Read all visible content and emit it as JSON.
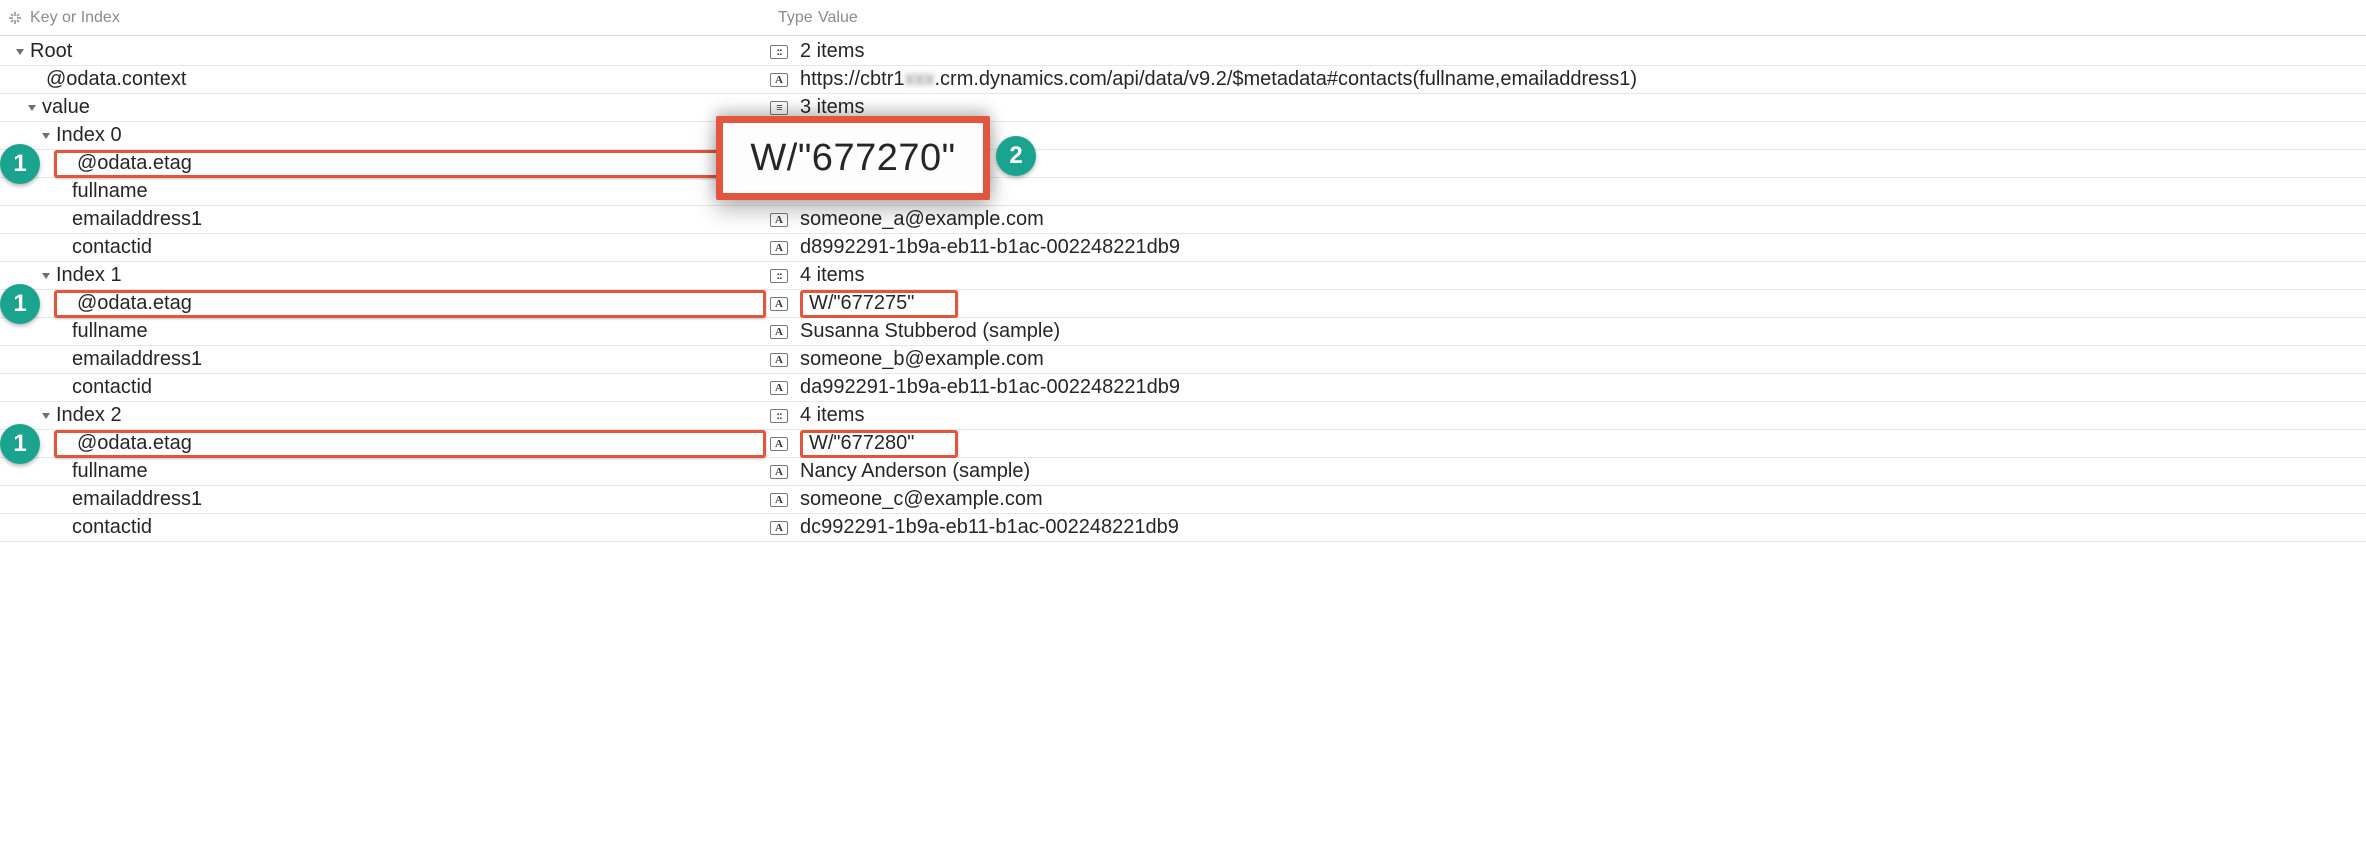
{
  "header": {
    "key_label": "Key or Index",
    "type_label": "Type",
    "value_label": "Value"
  },
  "callouts": {
    "one": "1",
    "two": "2"
  },
  "zoom_value": "W/\"677270\"",
  "root": {
    "label": "Root",
    "summary": "2 items",
    "odata_context": {
      "key": "@odata.context",
      "value_prefix": "https://cbtr1",
      "value_blurred": "xxx",
      "value_suffix": ".crm.dynamics.com/api/data/v9.2/$metadata#contacts(fullname,emailaddress1)"
    },
    "value": {
      "key": "value",
      "summary": "3 items",
      "items": [
        {
          "index_label": "Index 0",
          "summary": "",
          "etag": {
            "key": "@odata.etag",
            "value": "W/\"677270\""
          },
          "fullname": {
            "key": "fullname",
            "value": ""
          },
          "emailaddress1": {
            "key": "emailaddress1",
            "value": "someone_a@example.com"
          },
          "contactid": {
            "key": "contactid",
            "value": "d8992291-1b9a-eb11-b1ac-002248221db9"
          }
        },
        {
          "index_label": "Index 1",
          "summary": "4 items",
          "etag": {
            "key": "@odata.etag",
            "value": "W/\"677275\""
          },
          "fullname": {
            "key": "fullname",
            "value": "Susanna Stubberod (sample)"
          },
          "emailaddress1": {
            "key": "emailaddress1",
            "value": "someone_b@example.com"
          },
          "contactid": {
            "key": "contactid",
            "value": "da992291-1b9a-eb11-b1ac-002248221db9"
          }
        },
        {
          "index_label": "Index 2",
          "summary": "4 items",
          "etag": {
            "key": "@odata.etag",
            "value": "W/\"677280\""
          },
          "fullname": {
            "key": "fullname",
            "value": "Nancy Anderson (sample)"
          },
          "emailaddress1": {
            "key": "emailaddress1",
            "value": "someone_c@example.com"
          },
          "contactid": {
            "key": "contactid",
            "value": "dc992291-1b9a-eb11-b1ac-002248221db9"
          }
        }
      ]
    }
  }
}
